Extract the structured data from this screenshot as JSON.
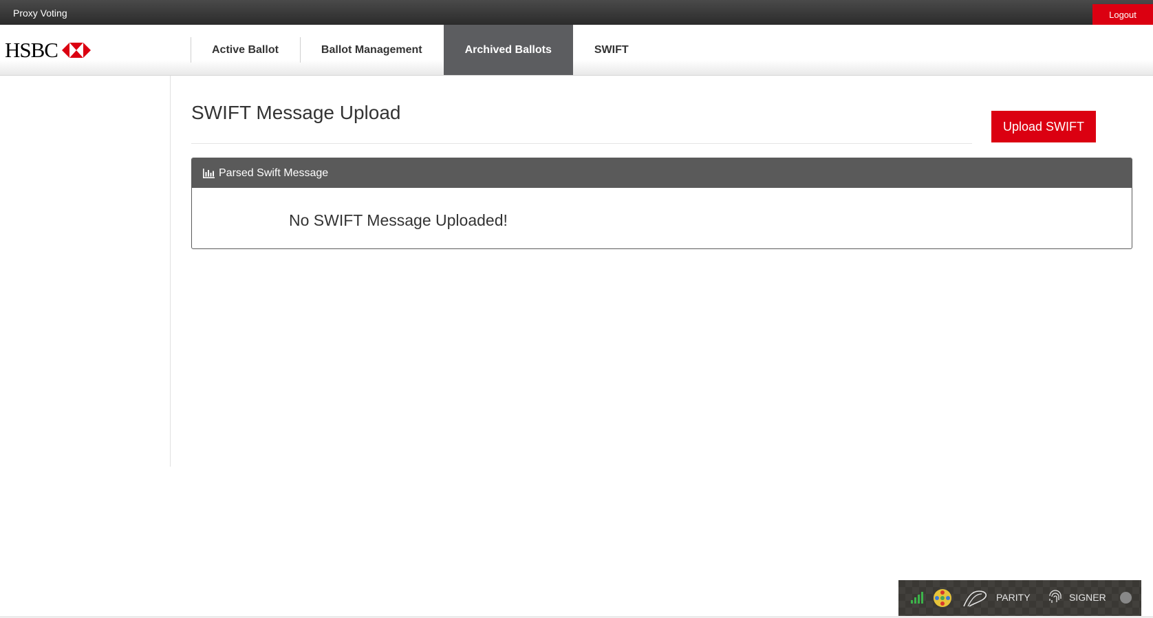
{
  "topbar": {
    "app_title": "Proxy Voting",
    "logout_label": "Logout"
  },
  "header": {
    "logo_text": "HSBC",
    "nav": [
      {
        "label": "Active Ballot",
        "active": false
      },
      {
        "label": "Ballot Management",
        "active": false
      },
      {
        "label": "Archived Ballots",
        "active": true
      },
      {
        "label": "SWIFT",
        "active": false
      }
    ]
  },
  "main": {
    "page_title": "SWIFT Message Upload",
    "upload_button_label": "Upload SWIFT",
    "panel": {
      "header_icon": "bar-chart-icon",
      "header_title": "Parsed Swift Message",
      "empty_message": "No SWIFT Message Uploaded!"
    }
  },
  "extension": {
    "parity_label": "PARITY",
    "signer_label": "SIGNER",
    "icons": [
      "signal-icon",
      "identicon-icon",
      "parity-logo-icon",
      "fingerprint-icon",
      "status-dot-icon"
    ]
  },
  "colors": {
    "brand_red": "#db0011",
    "topbar": "#333333",
    "nav_active": "#5c5d60",
    "panel_header": "#5a5a5a"
  }
}
